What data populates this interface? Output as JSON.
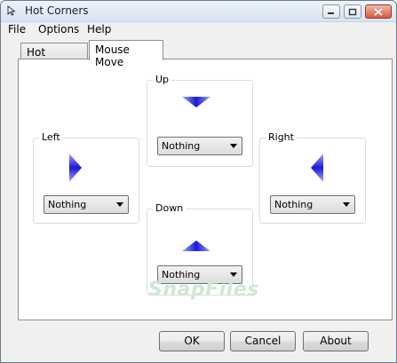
{
  "window": {
    "title": "Hot Corners",
    "icons": {
      "app": "cursor-arrow-icon",
      "minimize": "minimize-icon",
      "maximize": "maximize-icon",
      "close": "close-icon"
    }
  },
  "menu": {
    "items": [
      "File",
      "Options",
      "Help"
    ]
  },
  "tabs": [
    {
      "label": "Hot Corners",
      "selected": false
    },
    {
      "label": "Mouse Move",
      "selected": true
    }
  ],
  "directions": {
    "up": {
      "label": "Up",
      "selected": "Nothing",
      "arrow_icon": "arrow-up-triangle-icon"
    },
    "left": {
      "label": "Left",
      "selected": "Nothing",
      "arrow_icon": "arrow-right-triangle-icon"
    },
    "right": {
      "label": "Right",
      "selected": "Nothing",
      "arrow_icon": "arrow-left-triangle-icon"
    },
    "down": {
      "label": "Down",
      "selected": "Nothing",
      "arrow_icon": "arrow-down-triangle-icon"
    }
  },
  "arrow_color": "#1a1ad6",
  "watermark": "SnapFiles",
  "buttons": {
    "ok": "OK",
    "cancel": "Cancel",
    "about": "About"
  }
}
